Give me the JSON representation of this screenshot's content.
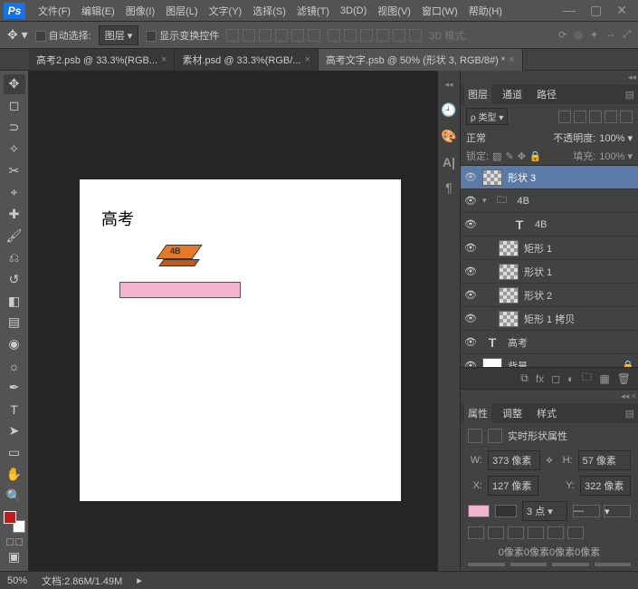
{
  "app": {
    "logo": "Ps"
  },
  "menu": {
    "file": "文件(F)",
    "edit": "编辑(E)",
    "image": "图像(I)",
    "layer": "图层(L)",
    "type": "文字(Y)",
    "select": "选择(S)",
    "filter": "滤镜(T)",
    "threed": "3D(D)",
    "view": "视图(V)",
    "window": "窗口(W)",
    "help": "帮助(H)"
  },
  "optbar": {
    "auto_select": "自动选择:",
    "auto_target": "图层 ▾",
    "show_controls": "显示变换控件",
    "threed_mode": "3D 模式:"
  },
  "tabs": [
    {
      "label": "高考2.psb @ 33.3%(RGB..."
    },
    {
      "label": "素材.psd @ 33.3%(RGB/..."
    },
    {
      "label": "高考文字.psb @ 50% (形状 3, RGB/8#) *",
      "active": true
    }
  ],
  "canvas": {
    "text1": "高考",
    "eraser_label": "4B"
  },
  "layers_panel": {
    "tab_layers": "图层",
    "tab_channels": "通道",
    "tab_paths": "路径",
    "kind": "ρ 类型 ▾",
    "blend": "正常",
    "opacity_label": "不透明度:",
    "opacity": "100% ▾",
    "lock_label": "锁定:",
    "fill_label": "填充:",
    "fill": "100% ▾",
    "layers": [
      {
        "name": "形状 3",
        "type": "shape",
        "selected": true
      },
      {
        "name": "4B",
        "type": "group"
      },
      {
        "name": "4B",
        "type": "text",
        "indent": 2
      },
      {
        "name": "矩形 1",
        "type": "shape",
        "indent": 1
      },
      {
        "name": "形状 1",
        "type": "shape",
        "indent": 1
      },
      {
        "name": "形状 2",
        "type": "shape",
        "indent": 1
      },
      {
        "name": "矩形 1 拷贝",
        "type": "shape",
        "indent": 1
      },
      {
        "name": "高考",
        "type": "text"
      },
      {
        "name": "背景",
        "type": "bg",
        "locked": true
      }
    ]
  },
  "props_panel": {
    "tab_props": "属性",
    "tab_adjust": "调整",
    "tab_styles": "样式",
    "title": "实时形状属性",
    "w_label": "W:",
    "w": "373 像素",
    "h_label": "H:",
    "h": "57 像素",
    "x_label": "X:",
    "x": "127 像素",
    "y_label": "Y:",
    "y": "322 像素",
    "stroke_width": "3 点 ▾",
    "corners": "0像素0像素0像素0像素"
  },
  "status": {
    "zoom": "50%",
    "doc": "文档:2.86M/1.49M"
  }
}
